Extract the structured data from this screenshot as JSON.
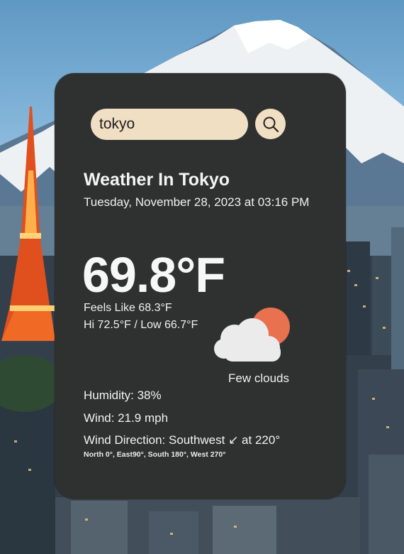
{
  "search": {
    "value": "tokyo"
  },
  "weather": {
    "title": "Weather In Tokyo",
    "datetime": "Tuesday, November 28, 2023 at 03:16 PM",
    "temperature": "69.8°F",
    "feels_like": "Feels Like 68.3°F",
    "hi_low": "Hi 72.5°F / Low 66.7°F",
    "condition": "Few clouds",
    "condition_icon": "few-clouds-icon",
    "humidity": "Humidity: 38%",
    "wind": "Wind: 21.9 mph",
    "wind_direction": "Wind Direction: Southwest ↙ at 220°",
    "compass_note": "North 0°, East90°, South 180°, West 270°"
  },
  "colors": {
    "card_background": "#2e3130",
    "search_background": "#f1dfc3",
    "sun": "#e8714f",
    "cloud": "#ebebeb"
  }
}
